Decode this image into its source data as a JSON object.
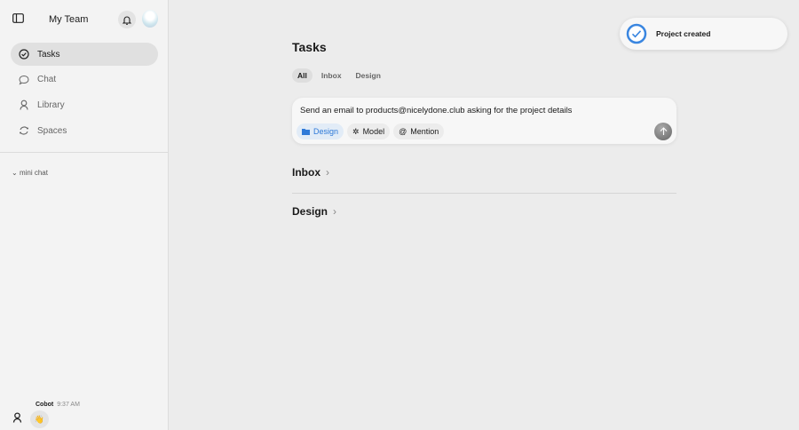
{
  "sidebar": {
    "team_name": "My Team",
    "nav": [
      {
        "label": "Tasks",
        "icon": "check-circle-icon"
      },
      {
        "label": "Chat",
        "icon": "chat-bubble-icon"
      },
      {
        "label": "Library",
        "icon": "person-icon"
      },
      {
        "label": "Spaces",
        "icon": "refresh-icon"
      }
    ],
    "mini_chat": "mini chat",
    "message": {
      "sender": "Cobot",
      "time": "9:37 AM",
      "content": "👋"
    }
  },
  "main": {
    "title": "Tasks",
    "tabs": [
      "All",
      "Inbox",
      "Design"
    ],
    "composer": {
      "text": "Send an email to products@nicelydone.club asking for the project details",
      "chips": [
        "Design",
        "Model",
        "Mention"
      ]
    },
    "sections": [
      "Inbox",
      "Design"
    ]
  },
  "toast": {
    "text": "Project created",
    "accent": "#3a86e0"
  }
}
